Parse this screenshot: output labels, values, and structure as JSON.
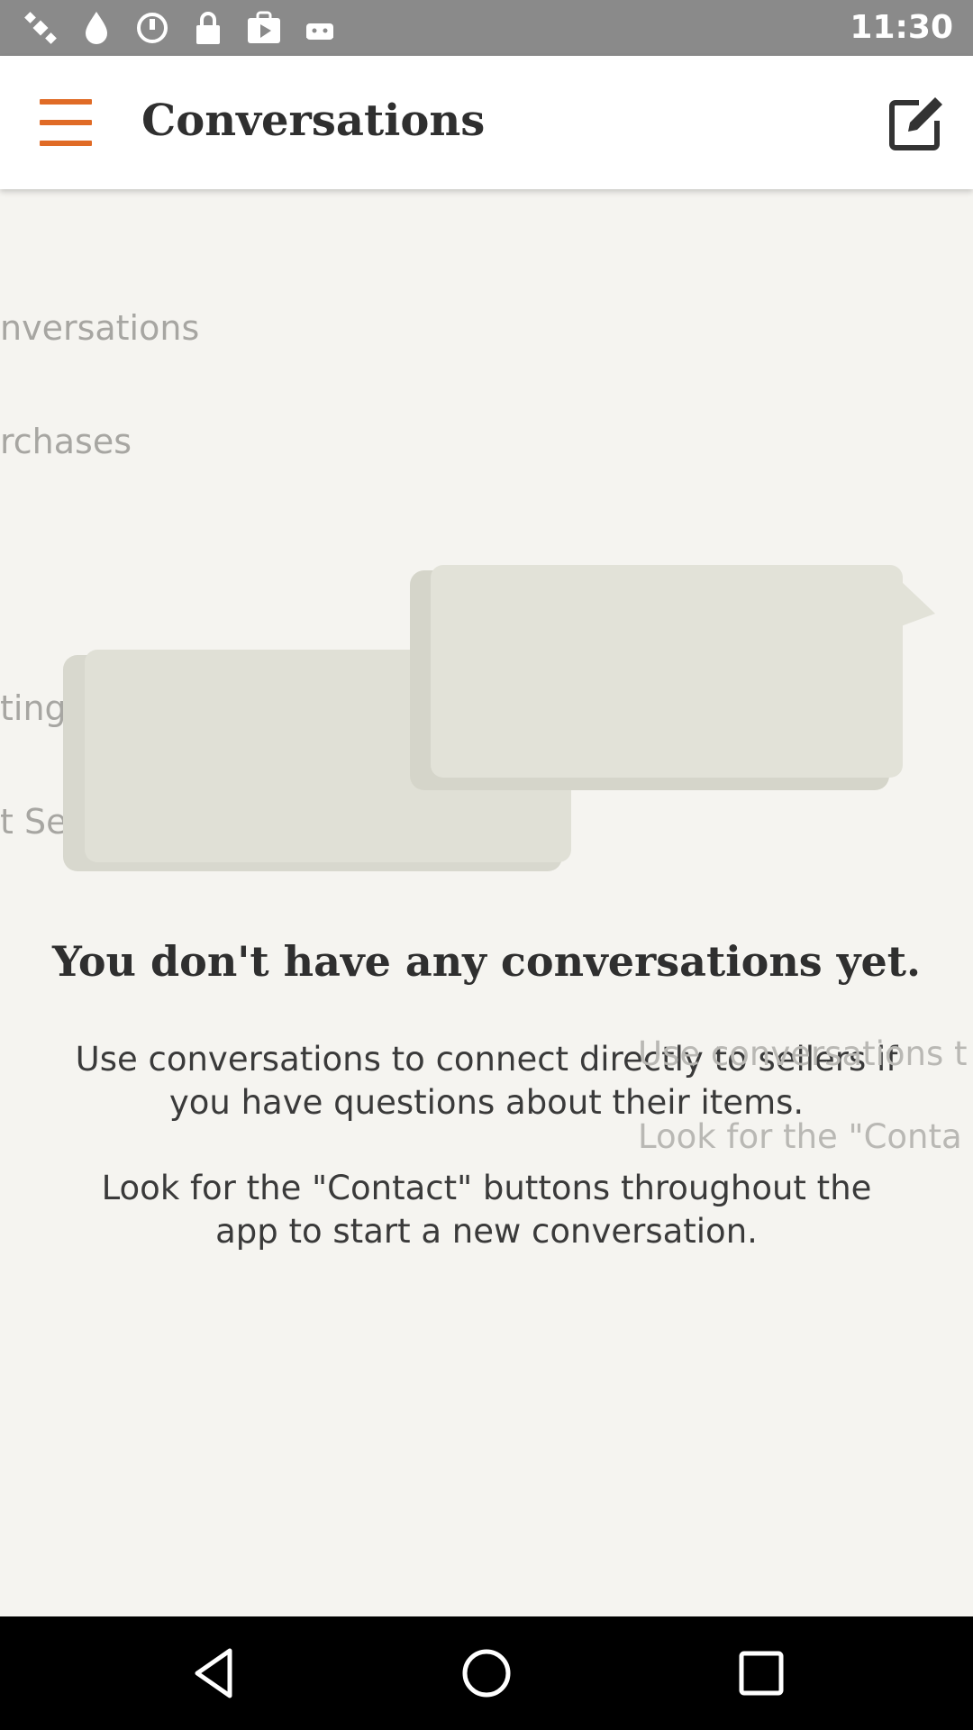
{
  "status_bar": {
    "time": "11:30",
    "icons": [
      "satellite-icon",
      "water-drop-icon",
      "timer-icon",
      "lock-icon",
      "play-store-icon",
      "android-icon"
    ]
  },
  "app_bar": {
    "title": "Conversations",
    "menu_icon": "hamburger-menu-icon",
    "compose_icon": "compose-icon"
  },
  "drawer_peek": {
    "items": [
      "nversations",
      "rchases",
      "tings",
      "t Sell on Etsy"
    ]
  },
  "empty_state": {
    "title": "You don't have any conversations yet.",
    "line1": "Use conversations to connect directly to sellers if",
    "line2": "you have questions about their items.",
    "line3": "Look for the \"Contact\" buttons throughout the",
    "line4": "app to start a new conversation."
  },
  "ghost_overlay": {
    "line1": "Use conversations t",
    "line2": "Look for the \"Conta"
  },
  "nav_bar": {
    "icons": [
      "back-icon",
      "home-icon",
      "recents-icon"
    ]
  },
  "colors": {
    "accent": "#e06b26",
    "background": "#f5f4f0",
    "status_bar": "#8a8a8a"
  }
}
